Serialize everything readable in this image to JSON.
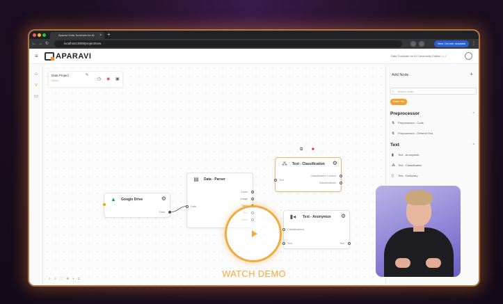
{
  "browser": {
    "tab_title": "Aparavi Data Toolchain for AI",
    "url": "localhost:3000/project/new",
    "chrome_button": "New Chrome available"
  },
  "app": {
    "logo": "APARAVI",
    "edition_prefix": "Data Toolchain for AI Community Edition",
    "edition_version": "v1.0"
  },
  "project": {
    "name": "Data Project",
    "status": "Saved"
  },
  "nodes": {
    "google_drive": {
      "title": "Google Drive",
      "out_port": "Data"
    },
    "data_parser": {
      "title": "Data - Parser",
      "in_port": "Data",
      "out_ports": [
        "Audio",
        "Image",
        "Table",
        "Text",
        "Video"
      ]
    },
    "text_classification": {
      "title": "Text - Classification",
      "in_port": "Text",
      "out_ports": [
        "Classification Context",
        "Classifications"
      ]
    },
    "text_anonymize": {
      "title": "Text - Anonymize",
      "in_port": "Classifications",
      "in_port2": "Text",
      "out_port": "Text"
    }
  },
  "panel": {
    "header": "Add Node",
    "search_placeholder": "Search Node",
    "chip": "Basic Set",
    "sections": [
      {
        "title": "Preprocessor",
        "items": [
          {
            "label": "Preprocessor - Code",
            "icon": "code-icon"
          },
          {
            "label": "Preprocessor - General Text",
            "icon": "text-split-icon"
          }
        ]
      },
      {
        "title": "Text",
        "items": [
          {
            "label": "Text - Anonymize",
            "icon": "anonymize-icon"
          },
          {
            "label": "Text - Classification",
            "icon": "classification-icon"
          },
          {
            "label": "Text - Dictionary",
            "icon": "dictionary-icon"
          }
        ]
      }
    ]
  },
  "overlay": {
    "watch_label": "WATCH DEMO"
  },
  "colors": {
    "accent": "#f4a93c",
    "background": "#1e0f24",
    "chrome_blue": "#2b5fc9"
  }
}
